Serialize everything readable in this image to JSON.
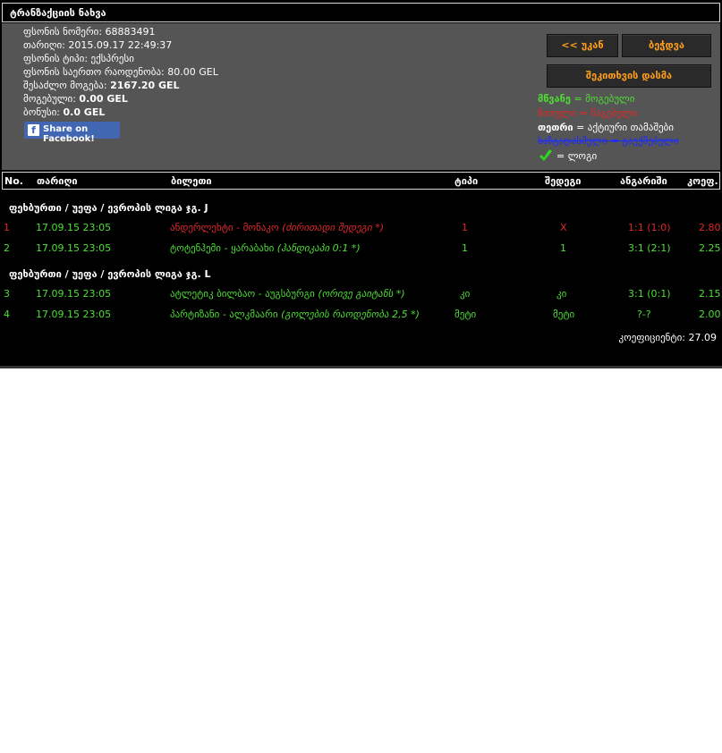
{
  "title": "ტრანზაქციის ნახვა",
  "ticket": {
    "number_label": "ფსონის ნომერი:",
    "number": "68883491",
    "date_label": "თარიღი:",
    "date": "2015.09.17 22:49:37",
    "type_label": "ფსონის ტიპი:",
    "type": "ექსპრესი",
    "total_odds_label": "ფსონის საერთო რაოდენობა:",
    "total_odds": "80.00 GEL",
    "possible_win_label": "შესაძლო მოგება:",
    "possible_win": "2167.20 GEL",
    "won_label": "მოგებული:",
    "won": "0.00 GEL",
    "bonus_label": "ბონუსი:",
    "bonus": "0.0 GEL"
  },
  "facebook_button": {
    "label": "Share on Facebook!"
  },
  "buttons": {
    "back": "<< უკან",
    "print": "ბეჭდვა",
    "close": "შეკითხვის დასმა"
  },
  "legend": {
    "green_word": "მწვანე",
    "green_text": " = მოგებული",
    "red_text": "წითელი = წაგებული",
    "white_word": "თეთრი",
    "white_text": " = აქტიური თამაშები",
    "blue_text": "ხაზგადასმული = გაუქმებული",
    "check_text": "= ლოგი"
  },
  "colors": {
    "green": "#4cdf33",
    "red": "#e0282b",
    "blue": "#1e2bff",
    "orange": "#ff9f1a",
    "panel": "#555555"
  },
  "table": {
    "headers": {
      "no": "No.",
      "date": "თარიღი",
      "ticket": "ბილეთი",
      "type": "ტიპი",
      "result": "შედეგი",
      "score": "ანგარიში",
      "odds": "კოეფ."
    },
    "groups": [
      {
        "title": "ფეხბურთი / უეფა / ევროპის ლიგა ჯგ. J",
        "rows": [
          {
            "no": "1",
            "date": "17.09.15 23:05",
            "match": "ანდერლეხტი - მონაკო",
            "bet": "(ძირითადი შედეგი *)",
            "type": "1",
            "result": "X",
            "score": "1:1 (1:0)",
            "odds": "2.80",
            "status": "red"
          },
          {
            "no": "2",
            "date": "17.09.15 23:05",
            "match": "ტოტენჰემი - ყარაბახი",
            "bet": "(ჰანდიკაპი 0:1 *)",
            "type": "1",
            "result": "1",
            "score": "3:1 (2:1)",
            "odds": "2.25",
            "status": "green"
          }
        ]
      },
      {
        "title": "ფეხბურთი / უეფა / ევროპის ლიგა ჯგ. L",
        "rows": [
          {
            "no": "3",
            "date": "17.09.15 23:05",
            "match": "ატლეტიკ ბილბაო - აუგსბურგი",
            "bet": "(ორივე გაიტანს *)",
            "type": "კი",
            "result": "კი",
            "score": "3:1 (0:1)",
            "odds": "2.15",
            "status": "green"
          },
          {
            "no": "4",
            "date": "17.09.15 23:05",
            "match": "პარტიზანი - ალკმაარი",
            "bet": "(გოლების რაოდენობა 2,5 *)",
            "type": "მეტი",
            "result": "მეტი",
            "score": "?-?",
            "odds": "2.00",
            "status": "green"
          }
        ]
      }
    ],
    "total": "კოეფიციენტი: 27.09"
  }
}
